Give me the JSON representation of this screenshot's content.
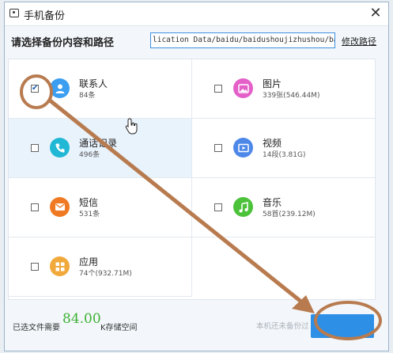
{
  "window": {
    "title": "手机备份",
    "close_label": "✕"
  },
  "path": {
    "label": "请选择备份内容和路径",
    "value": "lication Data/baidu/baidushoujizhushou/backup/",
    "modify_label": "修改路径"
  },
  "items": [
    {
      "name": "联系人",
      "meta": "84条",
      "checked": true,
      "icon": "contacts-icon",
      "color": "#3b9ef0"
    },
    {
      "name": "图片",
      "meta": "339张(546.44M)",
      "checked": false,
      "icon": "photos-icon",
      "color": "#e45fc8"
    },
    {
      "name": "通话记录",
      "meta": "496条",
      "checked": false,
      "icon": "call-log-icon",
      "color": "#21b8d6"
    },
    {
      "name": "视频",
      "meta": "14段(3.81G)",
      "checked": false,
      "icon": "video-icon",
      "color": "#4d88e8"
    },
    {
      "name": "短信",
      "meta": "531条",
      "checked": false,
      "icon": "sms-icon",
      "color": "#f07a23"
    },
    {
      "name": "音乐",
      "meta": "58首(239.12M)",
      "checked": false,
      "icon": "music-icon",
      "color": "#4cc23a"
    },
    {
      "name": "应用",
      "meta": "74个(932.71M)",
      "checked": false,
      "icon": "apps-icon",
      "color": "#f2a93b"
    }
  ],
  "footer": {
    "prefix": "已选文件需要",
    "size": "84.00",
    "suffix": "K存储空间",
    "hint": "本机还未备份过"
  },
  "colors": {
    "accent": "#2d8fe6",
    "annotation": "#b87b4f",
    "size_green": "#3cb034"
  }
}
